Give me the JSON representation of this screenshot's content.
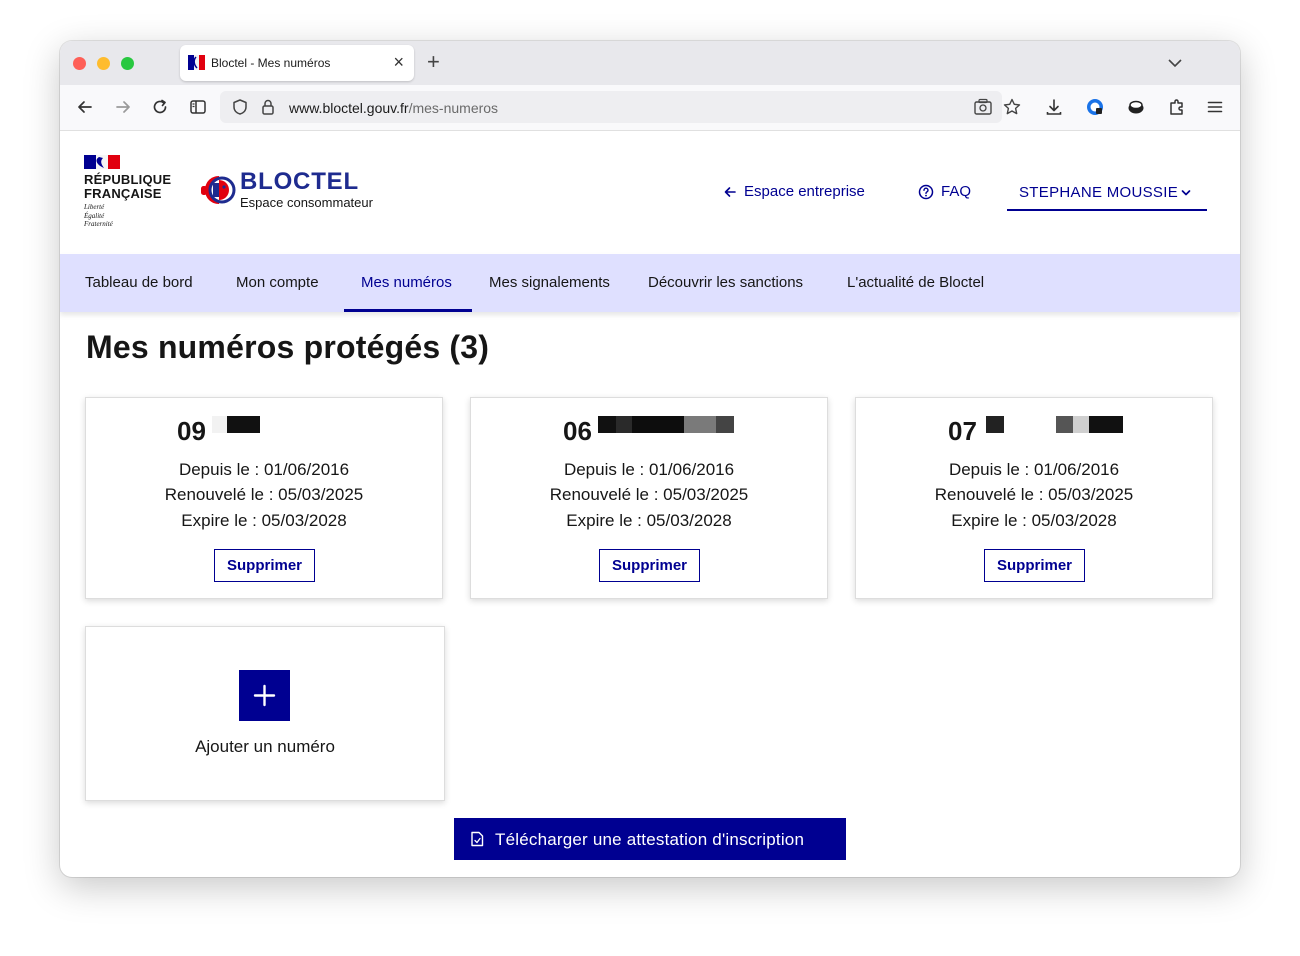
{
  "browser": {
    "tab_title": "Bloctel - Mes numéros",
    "url_domain": "www.bloctel.gouv.fr",
    "url_path": "/mes-numeros"
  },
  "header": {
    "republique_line1": "RÉPUBLIQUE",
    "republique_line2": "FRANÇAISE",
    "motto_1": "Liberté",
    "motto_2": "Égalité",
    "motto_3": "Fraternité",
    "brand_title": "BLOCTEL",
    "brand_subtitle": "Espace consommateur",
    "links": {
      "espace_entreprise": "Espace entreprise",
      "faq": "FAQ",
      "user_name": "STEPHANE MOUSSIE"
    }
  },
  "nav": {
    "items": [
      {
        "label": "Tableau de bord",
        "active": false
      },
      {
        "label": "Mon compte",
        "active": false
      },
      {
        "label": "Mes numéros",
        "active": true
      },
      {
        "label": "Mes signalements",
        "active": false
      },
      {
        "label": "Découvrir les sanctions",
        "active": false
      },
      {
        "label": "L'actualité de Bloctel",
        "active": false
      }
    ]
  },
  "main": {
    "title": "Mes numéros protégés (3)",
    "cards": [
      {
        "number_prefix": "09",
        "since": "Depuis le : 01/06/2016",
        "renewed": "Renouvelé le : 05/03/2025",
        "expires": "Expire le : 05/03/2028",
        "delete_label": "Supprimer"
      },
      {
        "number_prefix": "06",
        "since": "Depuis le : 01/06/2016",
        "renewed": "Renouvelé le : 05/03/2025",
        "expires": "Expire le : 05/03/2028",
        "delete_label": "Supprimer"
      },
      {
        "number_prefix": "07",
        "since": "Depuis le : 01/06/2016",
        "renewed": "Renouvelé le : 05/03/2025",
        "expires": "Expire le : 05/03/2028",
        "delete_label": "Supprimer"
      }
    ],
    "add_label": "Ajouter un numéro",
    "download_label": "Télécharger une attestation d'inscription"
  },
  "colors": {
    "primary": "#000091",
    "nav_background": "#dfe0ff",
    "text": "#161616",
    "brand_red": "#e1000f"
  }
}
